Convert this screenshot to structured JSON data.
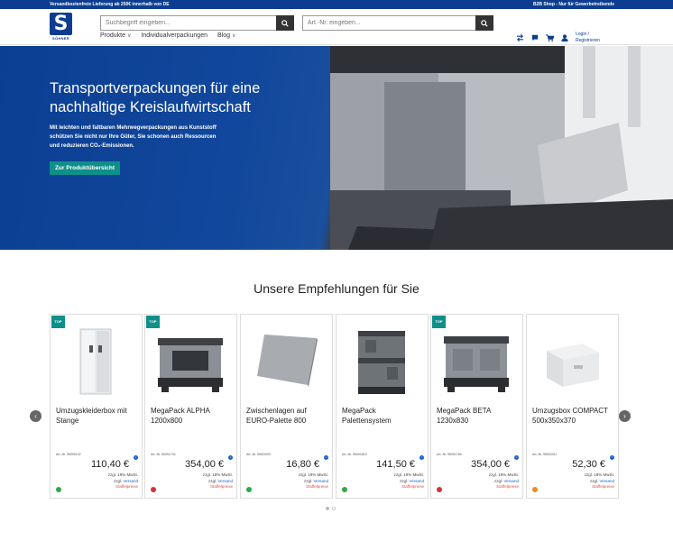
{
  "topbar": {
    "left": "Versandkostenfreie Lieferung ab 250€ innerhalb von DE",
    "right": "B2B Shop - Nur für Gewerbetreibende"
  },
  "logo": {
    "letter": "S",
    "text": "SÖHNER"
  },
  "search": {
    "placeholder": "Suchbegriff eingeben...",
    "art_placeholder": "Art.-Nr. eingeben..."
  },
  "nav": [
    {
      "label": "Produkte",
      "dropdown": true
    },
    {
      "label": "Individualverpackungen",
      "dropdown": false
    },
    {
      "label": "Blog",
      "dropdown": true
    }
  ],
  "account": {
    "line1": "Login /",
    "line2": "Registrieren"
  },
  "hero": {
    "title": "Transportverpackungen für eine nachhaltige Kreislaufwirtschaft",
    "line1": "Mit leichten und faltbaren Mehrwegverpackungen aus Kunststoff",
    "line2": "schützen Sie nicht nur Ihre Güter, Sie schonen auch Ressourcen",
    "line3": "und reduzieren CO₂-Emissionen.",
    "cta": "Zur Produktübersicht"
  },
  "section_title": "Unsere Empfehlungen für Sie",
  "products": [
    {
      "name": "Umzugskleiderbox mit Stange",
      "art": "Art.-Nr. 55090102",
      "price": "110,40 €",
      "top": true,
      "status": "#2ea84a",
      "image": "wardrobe-box"
    },
    {
      "name": "MegaPack ALPHA 1200x800",
      "art": "Art.-Nr. 55091704",
      "price": "354,00 €",
      "top": true,
      "status": "#d9303a",
      "image": "pallet-box-open"
    },
    {
      "name": "Zwischenlagen auf EURO-Palette 800",
      "art": "Art.-Nr. 55520007",
      "price": "16,80 €",
      "top": false,
      "status": "#2ea84a",
      "image": "layer-pad"
    },
    {
      "name": "MegaPack Palettensystem",
      "art": "Art.-Nr. 55091819",
      "price": "141,50 €",
      "top": false,
      "status": "#2ea84a",
      "image": "stacked-pallet-system"
    },
    {
      "name": "MegaPack BETA 1230x830",
      "art": "Art.-Nr. 55091765",
      "price": "354,00 €",
      "top": true,
      "status": "#d9303a",
      "image": "pallet-box-closed"
    },
    {
      "name": "Umzugsbox COMPACT 500x350x370",
      "art": "Art.-Nr. 55600311",
      "price": "52,30 €",
      "top": false,
      "status": "#f08a1c",
      "image": "moving-box"
    }
  ],
  "price_note": {
    "vat": "zzgl. 19% MwSt.",
    "ship_prefix": "zzgl.",
    "ship_link": "Versand",
    "tiers": "Staffelpreise"
  },
  "badge": "TOP",
  "colors": {
    "brand": "#0c3d91",
    "accent": "#0f8f8a",
    "link": "#1a63c4"
  }
}
